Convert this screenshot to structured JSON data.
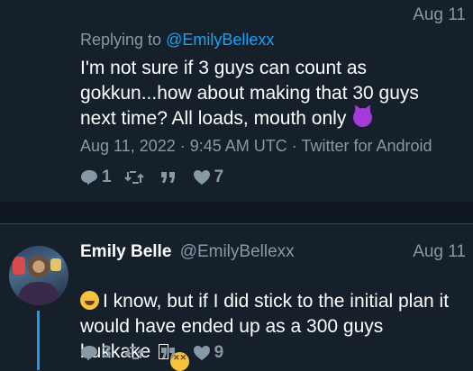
{
  "tweet1": {
    "date": "Aug 11",
    "replying_prefix": "Replying to ",
    "replying_mention": "@EmilyBellexx",
    "body": "I'm not sure if 3 guys can count as gokkun...how about making that 30 guys next time? All loads, mouth only",
    "body_emoji": "smiling-devil-emoji",
    "meta": "Aug 11, 2022 · 9:45 AM UTC · Twitter for Android",
    "actions": {
      "replies": "1",
      "retweets": "",
      "quotes": "",
      "likes": "7"
    }
  },
  "tweet2": {
    "display_name": "Emily Belle",
    "handle": "@EmilyBellexx",
    "date": "Aug 11",
    "body_lead_emoji": "laughing-tears-emoji",
    "body": "I know, but if I did stick to the initial plan it would have ended up as a 300 guys bukkake",
    "body_trailing_emoji": "dizzy-face-emoji",
    "actions": {
      "replies": "3",
      "retweets": "",
      "quotes": "",
      "likes": "9"
    }
  },
  "colors": {
    "background": "#15202b",
    "muted": "#8899a6",
    "link": "#1da1f2",
    "thread_line": "#1d9bf0"
  }
}
